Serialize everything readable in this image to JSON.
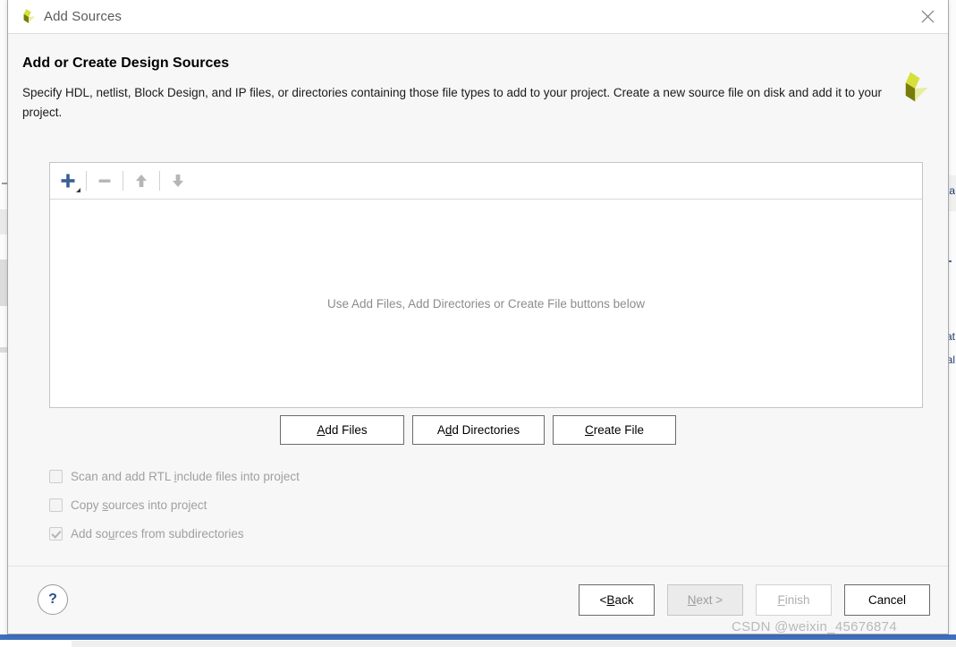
{
  "window": {
    "title": "Add Sources",
    "app_icon": "vivado-logo-icon",
    "close_icon": "close-icon"
  },
  "header": {
    "title": "Add or Create Design Sources",
    "description": "Specify HDL, netlist, Block Design, and IP files, or directories containing those file types to add to your project. Create a new source file on disk and add it to your project.",
    "logo_icon": "vivado-logo-icon"
  },
  "source_panel": {
    "toolbar": [
      {
        "name": "add-source-button",
        "icon": "plus-icon",
        "enabled": true,
        "has_dropdown": true
      },
      {
        "name": "remove-source-button",
        "icon": "minus-icon",
        "enabled": false,
        "has_dropdown": false
      },
      {
        "name": "move-up-button",
        "icon": "arrow-up-icon",
        "enabled": false,
        "has_dropdown": false
      },
      {
        "name": "move-down-button",
        "icon": "arrow-down-icon",
        "enabled": false,
        "has_dropdown": false
      }
    ],
    "empty_message": "Use Add Files, Add Directories or Create File buttons below"
  },
  "actions": [
    {
      "name": "add-files-button",
      "prefix": "",
      "mnemonic": "A",
      "suffix": "dd Files"
    },
    {
      "name": "add-directories-button",
      "prefix": "A",
      "mnemonic": "d",
      "suffix": "d Directories"
    },
    {
      "name": "create-file-button",
      "prefix": "",
      "mnemonic": "C",
      "suffix": "reate File"
    }
  ],
  "options": [
    {
      "name": "scan-rtl-include-checkbox",
      "prefix": "Scan and add RTL ",
      "mnemonic": "i",
      "suffix": "nclude files into project",
      "checked": false,
      "enabled": false
    },
    {
      "name": "copy-sources-checkbox",
      "prefix": "Copy ",
      "mnemonic": "s",
      "suffix": "ources into project",
      "checked": false,
      "enabled": false
    },
    {
      "name": "add-subdirectories-checkbox",
      "prefix": "Add so",
      "mnemonic": "u",
      "suffix": "rces from subdirectories",
      "checked": true,
      "enabled": false
    }
  ],
  "footer": {
    "help_label": "?",
    "buttons": [
      {
        "name": "back-button",
        "prefix": "< ",
        "mnemonic": "B",
        "suffix": "ack",
        "state": "enabled"
      },
      {
        "name": "next-button",
        "prefix": "",
        "mnemonic": "N",
        "suffix": "ext >",
        "state": "disabled-gray"
      },
      {
        "name": "finish-button",
        "prefix": "",
        "mnemonic": "F",
        "suffix": "inish",
        "state": "disabled-white"
      },
      {
        "name": "cancel-button",
        "prefix": "",
        "mnemonic": "",
        "suffix": "Cancel",
        "state": "enabled"
      }
    ]
  },
  "watermark": "CSDN @weixin_45676874",
  "background": {
    "text_fragments": [
      "ta",
      "at",
      "al"
    ]
  },
  "colors": {
    "accent_blue": "#2d4f86",
    "logo_bright": "#d6e03a",
    "logo_dark": "#787c0a",
    "logo_pale": "#e7eea0",
    "disabled_text": "#a0a0a0",
    "taskbar_blue": "#3f6fbf"
  }
}
